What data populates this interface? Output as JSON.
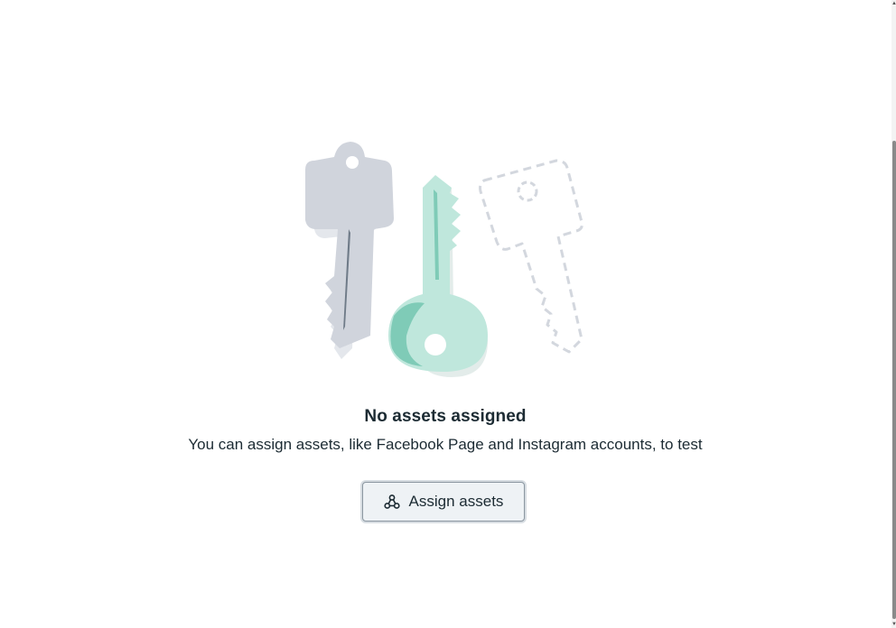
{
  "empty_state": {
    "title": "No assets assigned",
    "description": "You can assign assets, like Facebook Page and Instagram accounts, to test",
    "illustration_icon": "keys-illustration"
  },
  "actions": {
    "assign_label": "Assign assets",
    "assign_icon": "assets-nodes-icon"
  },
  "colors": {
    "text": "#1c2b33",
    "button_bg": "#eef2f5",
    "button_border": "#8a96a0",
    "key_gray": "#d0d4dc",
    "key_mint": "#bfe7dc",
    "key_mint_dark": "#7fcbb7"
  }
}
